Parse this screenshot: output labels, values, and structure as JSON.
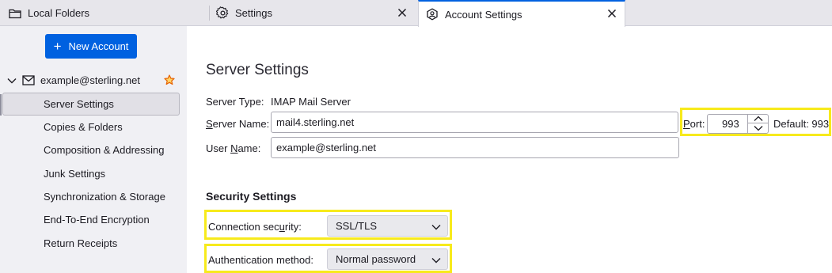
{
  "tabs": [
    {
      "label": "Local Folders",
      "icon": "folder-icon"
    },
    {
      "label": "Settings",
      "icon": "gear-icon"
    },
    {
      "label": "Account Settings",
      "icon": "account-settings-icon",
      "active": true
    }
  ],
  "sidebar": {
    "new_account_label": "New Account",
    "account_label": "example@sterling.net",
    "items": [
      {
        "label": "Server Settings",
        "selected": true
      },
      {
        "label": "Copies & Folders"
      },
      {
        "label": "Composition & Addressing"
      },
      {
        "label": "Junk Settings"
      },
      {
        "label": "Synchronization & Storage"
      },
      {
        "label": "End-To-End Encryption"
      },
      {
        "label": "Return Receipts"
      }
    ]
  },
  "main": {
    "title": "Server Settings",
    "server_type_label": "Server Type:",
    "server_type_value": "IMAP Mail Server",
    "server_name_label_pre": "",
    "server_name_label_ul": "S",
    "server_name_label_post": "erver Name:",
    "server_name_value": "mail4.sterling.net",
    "port_label_ul": "P",
    "port_label_post": "ort:",
    "port_value": "993",
    "default_label": "Default: 993",
    "user_name_label_pre": "User ",
    "user_name_label_ul": "N",
    "user_name_label_post": "ame:",
    "user_name_value": "example@sterling.net",
    "security_title": "Security Settings",
    "connection_security_label_pre": "Connection sec",
    "connection_security_label_ul": "u",
    "connection_security_label_post": "rity:",
    "connection_security_value": "SSL/TLS",
    "auth_method_label_pre": "Authentication method",
    "auth_method_label_post": ":",
    "auth_method_value": "Normal password"
  },
  "colors": {
    "accent": "#0061e0",
    "highlight": "#f7ea1c",
    "star": "#e66100"
  }
}
